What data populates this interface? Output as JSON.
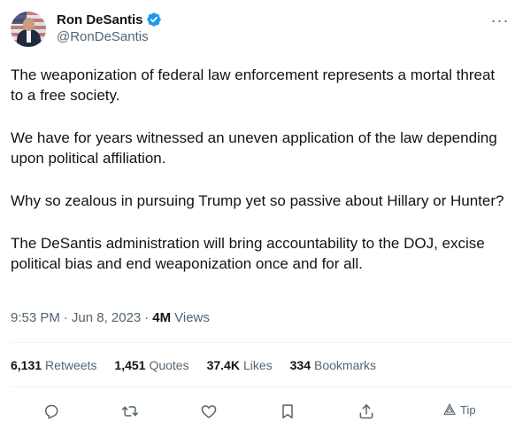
{
  "author": {
    "display_name": "Ron DeSantis",
    "handle": "@RonDeSantis",
    "verified": true,
    "verified_color": "#1d9bf0"
  },
  "more_label": "···",
  "tweet": {
    "paragraphs": [
      "The weaponization of federal law enforcement represents a mortal threat to a free society.",
      "We have for years witnessed an uneven application of the law depending upon political affiliation.",
      "Why so zealous in pursuing Trump yet so passive about Hillary or Hunter?",
      "The DeSantis administration will bring accountability to the DOJ, excise political bias and end weaponization once and for all."
    ]
  },
  "meta": {
    "time": "9:53 PM",
    "separator": "·",
    "date": "Jun 8, 2023",
    "views_count": "4M",
    "views_label": "Views"
  },
  "stats": {
    "retweets": {
      "count": "6,131",
      "label": "Retweets"
    },
    "quotes": {
      "count": "1,451",
      "label": "Quotes"
    },
    "likes": {
      "count": "37.4K",
      "label": "Likes"
    },
    "bookmarks": {
      "count": "334",
      "label": "Bookmarks"
    }
  },
  "actions": {
    "reply_icon": "reply-icon",
    "retweet_icon": "retweet-icon",
    "like_icon": "heart-icon",
    "bookmark_icon": "bookmark-icon",
    "share_icon": "share-icon",
    "tip_label": "Tip"
  },
  "colors": {
    "text_primary": "#0f1419",
    "text_secondary": "#536471",
    "divider": "#eff3f4"
  }
}
